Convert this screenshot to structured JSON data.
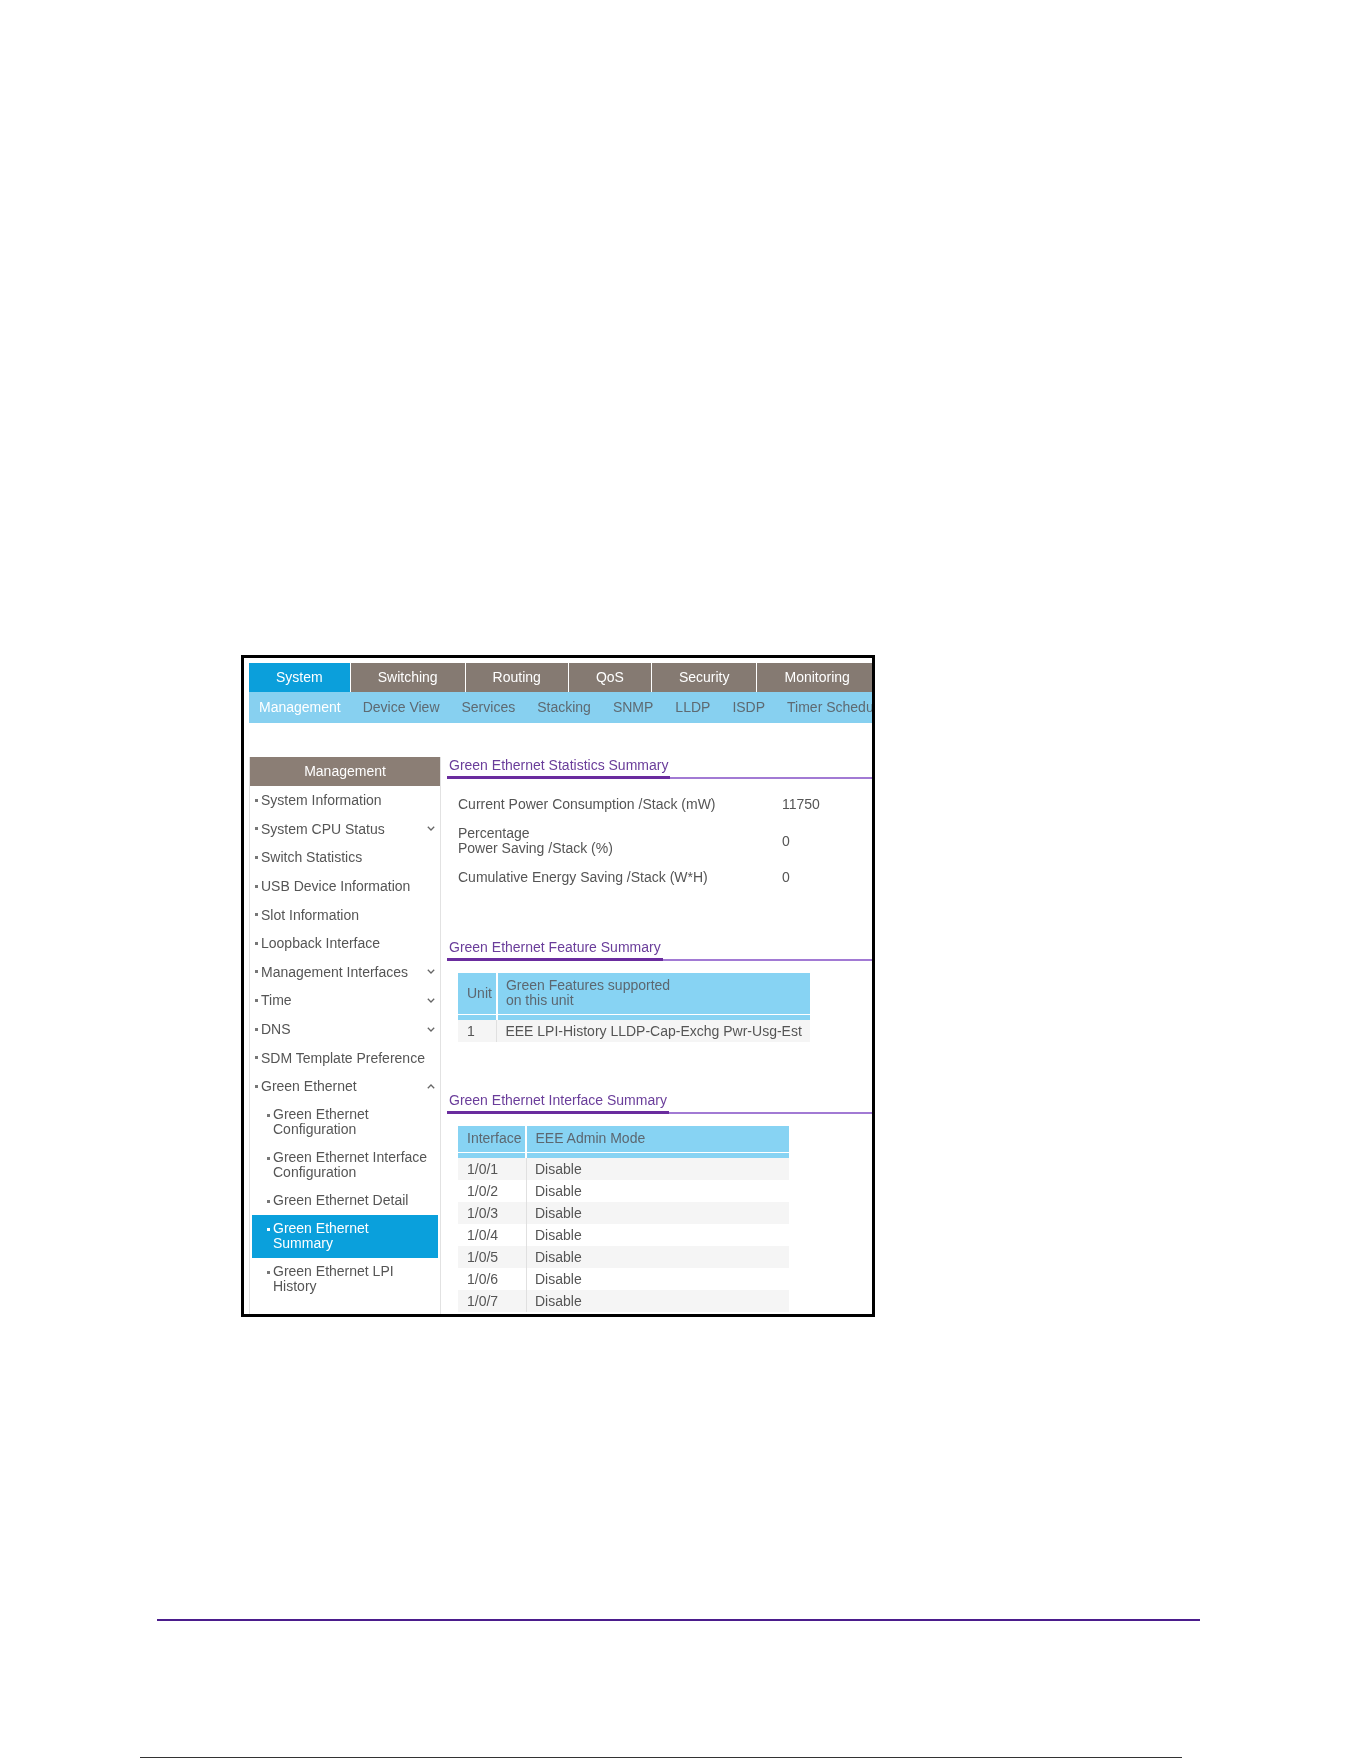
{
  "top_tabs": [
    {
      "label": "System",
      "selected": true
    },
    {
      "label": "Switching",
      "selected": false
    },
    {
      "label": "Routing",
      "selected": false
    },
    {
      "label": "QoS",
      "selected": false
    },
    {
      "label": "Security",
      "selected": false
    },
    {
      "label": "Monitoring",
      "selected": false
    }
  ],
  "sub_tabs": [
    {
      "label": "Management",
      "selected": true
    },
    {
      "label": "Device View",
      "selected": false
    },
    {
      "label": "Services",
      "selected": false
    },
    {
      "label": "Stacking",
      "selected": false
    },
    {
      "label": "SNMP",
      "selected": false
    },
    {
      "label": "LLDP",
      "selected": false
    },
    {
      "label": "ISDP",
      "selected": false
    },
    {
      "label": "Timer Schedu",
      "selected": false
    }
  ],
  "sidebar": {
    "title": "Management",
    "items": [
      {
        "label": "System Information",
        "kind": "link",
        "selected": false
      },
      {
        "label": "System CPU Status",
        "kind": "group",
        "expanded": false,
        "selected": false
      },
      {
        "label": "Switch Statistics",
        "kind": "link",
        "selected": false
      },
      {
        "label": "USB Device Information",
        "kind": "link",
        "selected": false
      },
      {
        "label": "Slot Information",
        "kind": "link",
        "selected": false
      },
      {
        "label": "Loopback Interface",
        "kind": "link",
        "selected": false
      },
      {
        "label": "Management Interfaces",
        "kind": "group",
        "expanded": false,
        "selected": false
      },
      {
        "label": "Time",
        "kind": "group",
        "expanded": false,
        "selected": false
      },
      {
        "label": "DNS",
        "kind": "group",
        "expanded": false,
        "selected": false
      },
      {
        "label": "SDM Template Preference",
        "kind": "link",
        "selected": false
      },
      {
        "label": "Green Ethernet",
        "kind": "group",
        "expanded": true,
        "selected": false,
        "children": [
          {
            "label": "Green Ethernet\nConfiguration",
            "selected": false
          },
          {
            "label": "Green Ethernet Interface\nConfiguration",
            "selected": false
          },
          {
            "label": "Green Ethernet Detail",
            "selected": false
          },
          {
            "label": "Green Ethernet\nSummary",
            "selected": true
          },
          {
            "label": "Green Ethernet LPI\nHistory",
            "selected": false
          }
        ]
      }
    ]
  },
  "sections": [
    {
      "kind": "stats",
      "title": "Green Ethernet Statistics Summary",
      "rows": [
        {
          "label": "Current Power Consumption /Stack (mW)",
          "value": "11750"
        },
        {
          "label": "Percentage\nPower Saving /Stack (%)",
          "value": "0"
        },
        {
          "label": "Cumulative Energy Saving /Stack (W*H)",
          "value": "0"
        }
      ]
    },
    {
      "kind": "table",
      "title": "Green Ethernet Feature Summary",
      "columns": [
        "Unit",
        "Green Features supported\non this unit"
      ],
      "rows": [
        [
          "1",
          "EEE LPI-History LLDP-Cap-Exchg Pwr-Usg-Est"
        ]
      ]
    },
    {
      "kind": "table",
      "title": "Green Ethernet Interface Summary",
      "columns": [
        "Interface",
        "EEE Admin Mode"
      ],
      "rows": [
        [
          "1/0/1",
          "Disable"
        ],
        [
          "1/0/2",
          "Disable"
        ],
        [
          "1/0/3",
          "Disable"
        ],
        [
          "1/0/4",
          "Disable"
        ],
        [
          "1/0/5",
          "Disable"
        ],
        [
          "1/0/6",
          "Disable"
        ],
        [
          "1/0/7",
          "Disable"
        ]
      ]
    }
  ]
}
